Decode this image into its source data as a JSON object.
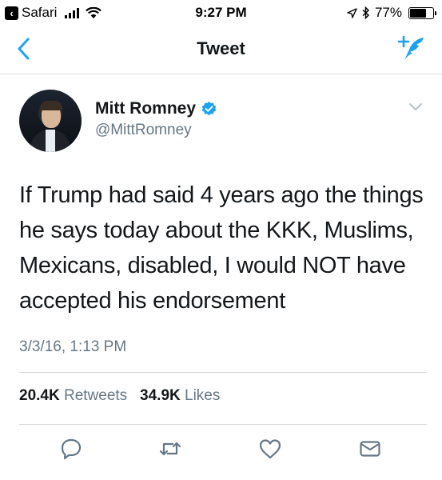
{
  "status_bar": {
    "back_app": "Safari",
    "time": "9:27 PM",
    "battery": "77%",
    "battery_level": 0.77
  },
  "nav": {
    "title": "Tweet"
  },
  "tweet": {
    "display_name": "Mitt Romney",
    "handle": "@MittRomney",
    "text": "If Trump had said 4 years ago the things he says today about the KKK, Muslims, Mexicans, disabled, I would NOT have accepted his endorsement",
    "timestamp": "3/3/16, 1:13 PM",
    "retweets_count": "20.4K",
    "retweets_label": "Retweets",
    "likes_count": "34.9K",
    "likes_label": "Likes"
  },
  "colors": {
    "accent": "#1da1f2",
    "text": "#14171a",
    "secondary": "#657786",
    "divider": "#d9d9d9"
  },
  "icons": {
    "back": "chevron-left-icon",
    "compose": "compose-tweet-icon",
    "verified": "verified-badge-icon",
    "more": "chevron-down-icon",
    "reply": "reply-icon",
    "retweet": "retweet-icon",
    "like": "heart-icon",
    "message": "envelope-icon"
  }
}
